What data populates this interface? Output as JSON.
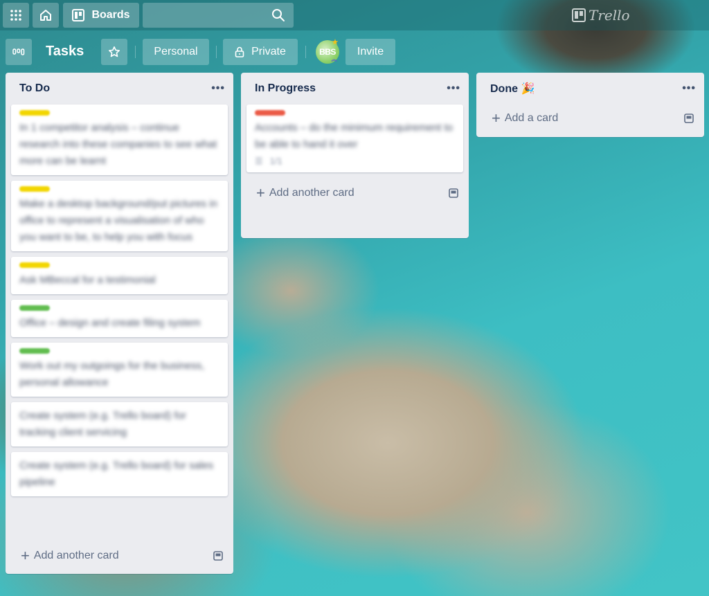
{
  "topbar": {
    "apps_icon": "grid-icon",
    "home_icon": "home-icon",
    "boards_label": "Boards",
    "search_placeholder": "",
    "logo_text": "Trello"
  },
  "boardbar": {
    "board_menu_icon": "board-switcher-icon",
    "title": "Tasks",
    "star_icon": "star-icon",
    "team_label": "Personal",
    "visibility_label": "Private",
    "avatar_initials": "BBS",
    "invite_label": "Invite"
  },
  "lists": [
    {
      "title": "To Do",
      "cards": [
        {
          "label_color": "#f2d600",
          "text": "In 1 competitor analysis – continue research into these companies to see what more can be learnt"
        },
        {
          "label_color": "#f2d600",
          "text": "Make a desktop background/put pictures in office to represent a visualisation of who you want to be, to help you with focus"
        },
        {
          "label_color": "#f2d600",
          "text": "Ask MBeccal for a testimonial"
        },
        {
          "label_color": "#61bd4f",
          "text": "Office – design and create filing system"
        },
        {
          "label_color": "#61bd4f",
          "text": "Work out my outgoings for the business, personal allowance"
        },
        {
          "label_color": "",
          "text": "Create system (e.g. Trello board) for tracking client servicing"
        },
        {
          "label_color": "",
          "text": "Create system (e.g. Trello board) for sales pipeline"
        }
      ],
      "add_label": "Add another card"
    },
    {
      "title": "In Progress",
      "cards": [
        {
          "label_color": "#eb5a46",
          "text": "Accounts – do the minimum requirement to be able to hand it over",
          "badges": [
            "☰",
            "1/1"
          ]
        }
      ],
      "add_label": "Add another card"
    },
    {
      "title": "Done 🎉",
      "cards": [],
      "add_label": "Add a card"
    }
  ],
  "icons": {
    "list_menu": "more-horizontal-icon",
    "add": "plus-icon",
    "template": "card-template-icon"
  }
}
